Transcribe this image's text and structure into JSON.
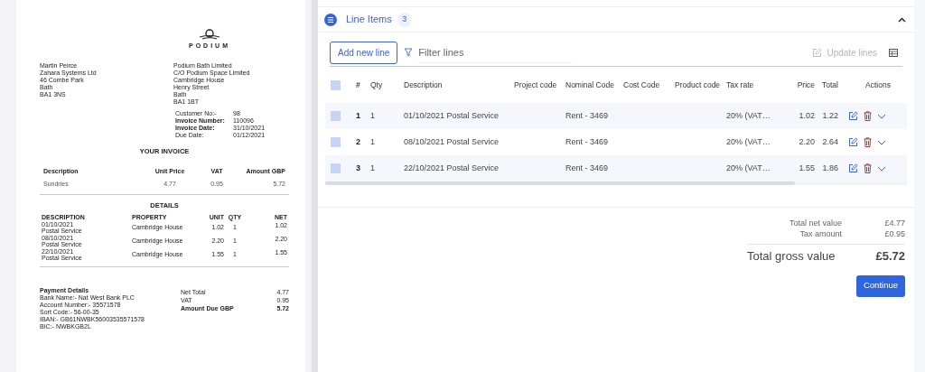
{
  "document": {
    "logo_text": "PODIUM",
    "customer_address": [
      "Martin Peirce",
      "Zahara Systems Ltd",
      "46 Combe Park",
      "Bath",
      "BA1 3NS"
    ],
    "supplier_address": [
      "Podium Bath Limited",
      "C/O Podium Space Limited",
      "Cambridge House",
      "Henry Street",
      "Bath",
      "BA1 1BT"
    ],
    "meta": [
      {
        "label": "Customer No:-",
        "value": "98",
        "bold": false
      },
      {
        "label": "Invoice Number:",
        "value": "110096",
        "bold": true
      },
      {
        "label": "Invoice Date:",
        "value": "31/10/2021",
        "bold": true
      },
      {
        "label": "Due Date:",
        "value": "01/12/2021",
        "bold": false
      }
    ],
    "invoice_title": "YOUR INVOICE",
    "summary_columns": [
      "Description",
      "Unit Price",
      "VAT",
      "Amount GBP"
    ],
    "summary_rows": [
      [
        "Sundries",
        "4.77",
        "0.95",
        "5.72"
      ]
    ],
    "details_title": "DETAILS",
    "details_columns": [
      "DESCRIPTION",
      "PROPERTY",
      "UNIT",
      "QTY",
      "NET"
    ],
    "details_rows": [
      {
        "date": "01/10/2021",
        "text": "Postal Service",
        "property": "Cambridge House",
        "unit": "1.02",
        "qty": "1",
        "net": "1.02"
      },
      {
        "date": "08/10/2021",
        "text": "Postal Service",
        "property": "Cambridge House",
        "unit": "2.20",
        "qty": "1",
        "net": "2.20"
      },
      {
        "date": "22/10/2021",
        "text": "Postal Service",
        "property": "Cambridge House",
        "unit": "1.55",
        "qty": "1",
        "net": "1.55"
      }
    ],
    "payment_title": "Payment Details",
    "payment_lines": [
      "Bank Name:- Nat West Bank PLC",
      "Account Number:- 35571578",
      "Sort Code:- 56-00-35",
      "IBAN:- GB61NWBK56003535571578",
      "BIC:- NWBKGB2L"
    ],
    "totals": [
      {
        "label": "Net Total",
        "value": "4.77",
        "bold": false
      },
      {
        "label": "VAT",
        "value": "0.95",
        "bold": false
      },
      {
        "label": "Amount Due GBP",
        "value": "5.72",
        "bold": true
      }
    ]
  },
  "line_items": {
    "title": "Line Items",
    "count": "3",
    "expanded": true,
    "add_button": "Add new line",
    "filter_placeholder": "Filter lines",
    "update_button": {
      "label": "Update lines",
      "disabled": true
    },
    "all_selected": false,
    "columns": [
      "#",
      "Qty",
      "Description",
      "Project code",
      "Nominal Code",
      "Cost Code",
      "Product code",
      "Tax rate",
      "Price",
      "Total",
      "Actions"
    ],
    "rows": [
      {
        "checked": false,
        "number": "1",
        "qty": "1",
        "description": "01/10/2021 Postal Service",
        "nominal_code": "Rent - 3469",
        "tax_rate": "20% (VAT…",
        "price": "1.02",
        "total": "1.22"
      },
      {
        "checked": false,
        "number": "2",
        "qty": "1",
        "description": "08/10/2021 Postal Service",
        "nominal_code": "Rent - 3469",
        "tax_rate": "20% (VAT…",
        "price": "2.20",
        "total": "2.64"
      },
      {
        "checked": false,
        "number": "3",
        "qty": "1",
        "description": "22/10/2021 Postal Service",
        "nominal_code": "Rent - 3469",
        "tax_rate": "20% (VAT…",
        "price": "1.55",
        "total": "1.86"
      }
    ],
    "totals": [
      {
        "label": "Total net value",
        "value": "£4.77"
      },
      {
        "label": "Tax amount",
        "value": "£0.95"
      }
    ],
    "gross": {
      "label": "Total gross value",
      "value": "£5.72"
    },
    "continue_button": "Continue"
  }
}
